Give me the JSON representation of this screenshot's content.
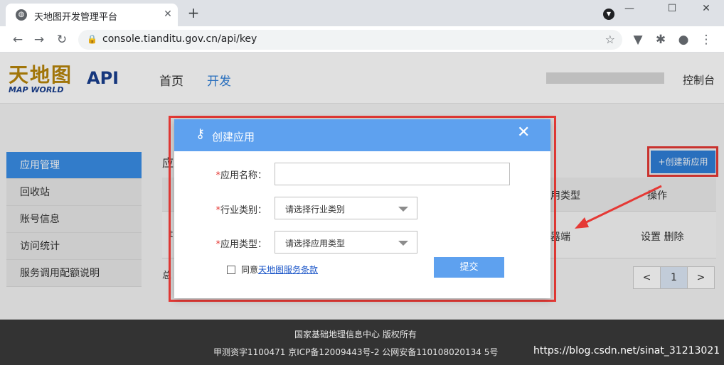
{
  "browser": {
    "tab_title": "天地图开发管理平台",
    "url": "console.tianditu.gov.cn/api/key",
    "icons": [
      "globe-icon",
      "close-icon",
      "plus-icon",
      "back-icon",
      "forward-icon",
      "reload-icon",
      "lock-icon",
      "star-icon",
      "extension-icon",
      "puzzle-icon",
      "profile-icon",
      "more-icon"
    ]
  },
  "header": {
    "logo_cn": "天地图",
    "logo_en": "MAP WORLD",
    "logo_api": "API",
    "nav": {
      "home": "首页",
      "dev": "开发"
    },
    "console": "控制台"
  },
  "sidebar": {
    "items": [
      {
        "label": "应用管理",
        "active": true
      },
      {
        "label": "回收站"
      },
      {
        "label": "账号信息"
      },
      {
        "label": "访问统计"
      },
      {
        "label": "服务调用配额说明"
      }
    ]
  },
  "content": {
    "title_partial": "应",
    "create_button": "+创建新应用",
    "table": {
      "col_type_partial": "用类型",
      "col_ops": "操作",
      "row_left_partial": "t",
      "row_type_partial": "器端",
      "row_ops": "设置 删除"
    },
    "summary_partial": "总",
    "pager": {
      "prev": "<",
      "current": "1",
      "next": ">"
    }
  },
  "modal": {
    "title": "创建应用",
    "close": "✕",
    "fields": {
      "name_label": "应用名称：",
      "industry_label": "行业类别：",
      "industry_placeholder": "请选择行业类别",
      "type_label": "应用类型：",
      "type_placeholder": "请选择应用类型",
      "required_mark": "*"
    },
    "agree_prefix": "同意",
    "agree_link": "天地图服务条款",
    "submit": "提交"
  },
  "footer": {
    "line1": "国家基础地理信息中心  版权所有",
    "line2": "甲测资字1100471  京ICP备12009443号-2  公网安备110108020134 5号",
    "watermark": "https://blog.csdn.net/sinat_31213021"
  },
  "colors": {
    "accent": "#2f7fd8",
    "modal_header": "#5ea1ef",
    "annotation": "#e53935"
  }
}
